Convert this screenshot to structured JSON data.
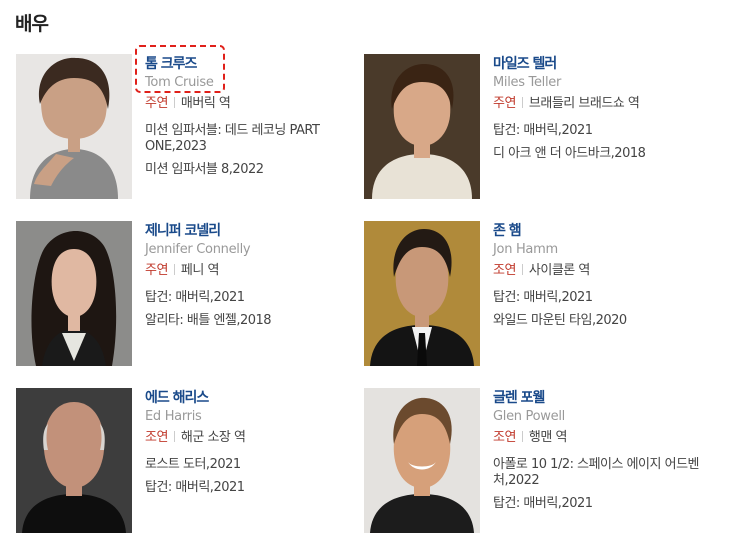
{
  "section": {
    "title": "배우"
  },
  "actors": [
    {
      "name_ko": "톰 크루즈",
      "name_en": "Tom Cruise",
      "role_type": "주연",
      "role_name": "매버릭 역",
      "works": [
        "미션 임파서블: 데드 레코닝 PART ONE,2023",
        "미션 임파서블 8,2022"
      ]
    },
    {
      "name_ko": "마일즈 텔러",
      "name_en": "Miles Teller",
      "role_type": "주연",
      "role_name": "브래들리 브래드쇼 역",
      "works": [
        "탑건: 매버릭,2021",
        "디 아크 앤 더 아드바크,2018"
      ]
    },
    {
      "name_ko": "제니퍼 코넬리",
      "name_en": "Jennifer Connelly",
      "role_type": "주연",
      "role_name": "페니 역",
      "works": [
        "탑건: 매버릭,2021",
        "알리타: 배틀 엔젤,2018"
      ]
    },
    {
      "name_ko": "존 햄",
      "name_en": "Jon Hamm",
      "role_type": "조연",
      "role_name": "사이클론 역",
      "works": [
        "탑건: 매버릭,2021",
        "와일드 마운틴 타임,2020"
      ]
    },
    {
      "name_ko": "에드 해리스",
      "name_en": "Ed Harris",
      "role_type": "조연",
      "role_name": "해군 소장 역",
      "works": [
        "로스트 도터,2021",
        "탑건: 매버릭,2021"
      ]
    },
    {
      "name_ko": "글렌 포웰",
      "name_en": "Glen Powell",
      "role_type": "조연",
      "role_name": "행맨 역",
      "works": [
        "아폴로 10 1/2: 스페이스 에이지 어드벤처,2022",
        "탑건: 매버릭,2021"
      ]
    }
  ],
  "colors": {
    "name_link": "#1a4a8a",
    "role_type": "#c0392b",
    "highlight": "#e0201a"
  }
}
